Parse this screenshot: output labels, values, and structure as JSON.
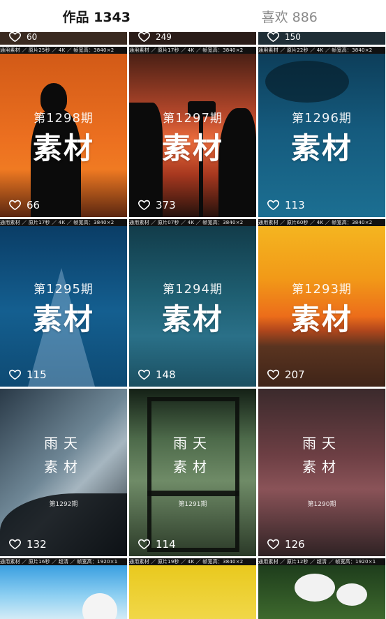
{
  "tabs": [
    {
      "label": "作品 1343",
      "active": true
    },
    {
      "label": "喜欢 886",
      "active": false
    }
  ],
  "top_partial_likes": [
    "60",
    "249",
    "150"
  ],
  "rows": [
    {
      "strips": [
        "通用素材 ／ 原片25秒 ／ 4K ／ 帧宽高：3840×2",
        "通用素材 ／ 原片17秒 ／ 4K ／ 帧宽高：3840×2",
        "通用素材 ／ 原片22秒 ／ 4K ／ 帧宽高：3840×2"
      ],
      "tiles": [
        {
          "period_prefix": "第",
          "period_num": "1298",
          "period_suffix": "期",
          "title": "素材",
          "likes": "66",
          "bg": "linear-gradient(180deg,#c84f15 0%,#e86b18 45%,#f07a22 70%,#6a2e10 100%)"
        },
        {
          "period_prefix": "第",
          "period_num": "1297",
          "period_suffix": "期",
          "title": "素材",
          "likes": "373",
          "bg": "linear-gradient(180deg,#3b1a12 0%,#b2452a 40%,#e66a3c 55%,#a7381f 75%,#2b140f 100%)"
        },
        {
          "period_prefix": "第",
          "period_num": "1296",
          "period_suffix": "期",
          "title": "素材",
          "likes": "113",
          "bg": "linear-gradient(180deg,#0d3e5a 0%,#145a7c 50%,#1c6f92 100%)"
        }
      ]
    },
    {
      "strips": [
        "通用素材 ／ 原片17秒 ／ 4K ／ 帧宽高：3840×2",
        "通用素材 ／ 原片07秒 ／ 4K ／ 帧宽高：3840×2",
        "通用素材 ／ 原片60秒 ／ 4K ／ 帧宽高：3840×2"
      ],
      "tiles": [
        {
          "period_prefix": "第",
          "period_num": "1295",
          "period_suffix": "期",
          "title": "素材",
          "likes": "115",
          "bg": "linear-gradient(180deg,#0a3d66 0%,#135e8f 55%,#0e4a73 100%)"
        },
        {
          "period_prefix": "第",
          "period_num": "1294",
          "period_suffix": "期",
          "title": "素材",
          "likes": "148",
          "bg": "linear-gradient(180deg,#123c4a 0%,#1d5d70 45%,#2a7088 70%,#1b4f61 100%)"
        },
        {
          "period_prefix": "第",
          "period_num": "1293",
          "period_suffix": "期",
          "title": "素材",
          "likes": "207",
          "bg": "linear-gradient(180deg,#f4b520 0%,#f29a18 35%,#ec6d1a 60%,#a7421c 72%,#3f2418 100%)"
        }
      ]
    },
    {
      "strips": [],
      "tiles": [
        {
          "rain_line1": "雨天",
          "rain_line2": "素材",
          "rain_sub": "第1292期",
          "likes": "132",
          "bg": "linear-gradient(135deg,#2a3a48 0%,#6f8796 45%,#a6b6c0 60%,#1d262d 100%)"
        },
        {
          "rain_line1": "雨天",
          "rain_line2": "素材",
          "rain_sub": "第1291期",
          "likes": "114",
          "bg": "linear-gradient(180deg,#142016 0%,#4d6a4a 30%,#6f8b67 55%,#2b3a28 100%)"
        },
        {
          "rain_line1": "雨天",
          "rain_line2": "素材",
          "rain_sub": "第1290期",
          "likes": "126",
          "bg": "linear-gradient(180deg,#3b2a2c 0%,#6d3f44 40%,#8a5358 60%,#2f2224 100%)"
        }
      ]
    },
    {
      "strips": [
        "通用素材 ／ 原片16秒 ／ 超清 ／ 帧宽高：1920×1",
        "通用素材 ／ 原片19秒 ／ 4K ／ 帧宽高：3840×2",
        "通用素材 ／ 原片12秒 ／ 超清 ／ 帧宽高：1920×1"
      ],
      "tiles": [
        {
          "likes": "",
          "bg": "linear-gradient(180deg,#3a9fe0 0%,#8fd0f2 60%,#d9eef7 100%)"
        },
        {
          "likes": "",
          "bg": "linear-gradient(180deg,#e9c91e 0%,#f1d84a 100%)"
        },
        {
          "likes": "",
          "bg": "linear-gradient(180deg,#1e3d1c 0%,#3f6b2e 100%)"
        }
      ]
    }
  ],
  "colors": {
    "tab_active": "#161616",
    "tab_inactive": "#8a8a8a",
    "separator": "#ffffff"
  }
}
